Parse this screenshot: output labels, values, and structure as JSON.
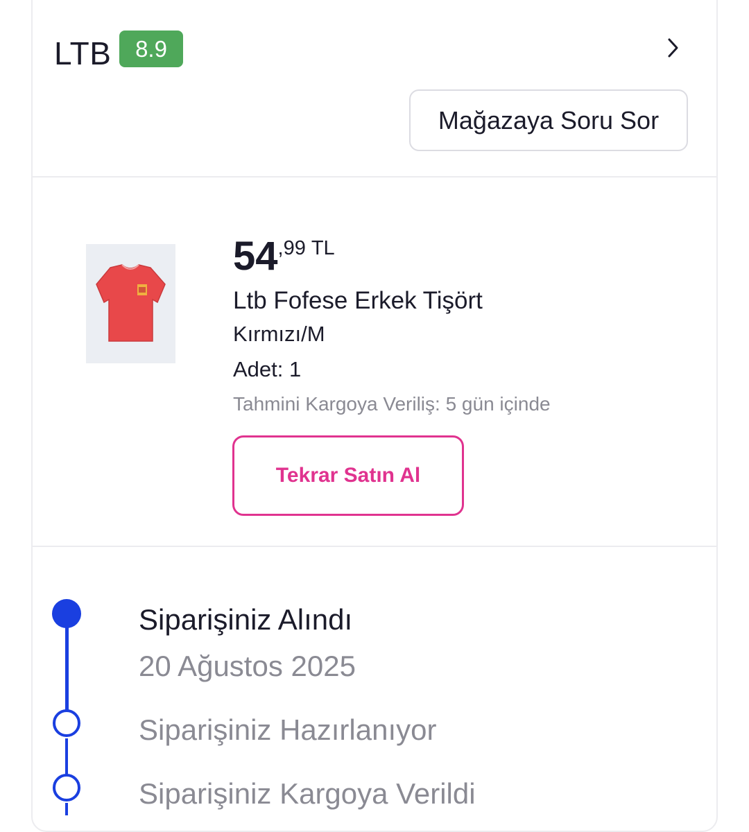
{
  "seller": {
    "name": "LTB",
    "rating": "8.9",
    "ask_button_label": "Mağazaya Soru Sor"
  },
  "product": {
    "price_integer": "54",
    "price_decimal": ",99",
    "price_currency": "TL",
    "name": "Ltb Fofese Erkek Tişört",
    "variant": "Kırmızı/M",
    "quantity_label": "Adet: 1",
    "eta_label": "Tahmini Kargoya Veriliş: 5 gün içinde",
    "rebuy_button_label": "Tekrar Satın Al",
    "image_icon": "red-tshirt-image"
  },
  "timeline": {
    "steps": [
      {
        "title": "Siparişiniz Alındı",
        "date": "20 Ağustos 2025",
        "status": "completed"
      },
      {
        "title": "Siparişiniz Hazırlanıyor",
        "status": "pending"
      },
      {
        "title": "Siparişiniz Kargoya Verildi",
        "status": "pending"
      }
    ]
  },
  "colors": {
    "rating_badge": "#4fa85a",
    "accent_pink": "#e0338f",
    "timeline_blue": "#1a3fe0",
    "muted_text": "#8a8a93"
  }
}
